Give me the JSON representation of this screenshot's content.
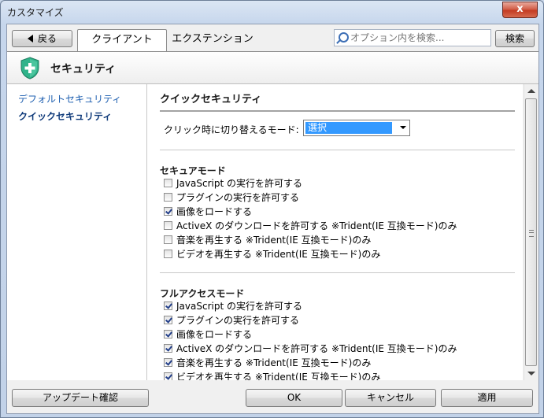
{
  "window": {
    "title": "カスタマイズ",
    "close_glyph": "x"
  },
  "toolbar": {
    "back_label": "戻る",
    "tabs": [
      {
        "label": "クライアント",
        "active": true
      },
      {
        "label": "エクステンション",
        "active": false
      }
    ],
    "search_placeholder": "オプション内を検索...",
    "search_button": "検索"
  },
  "header": {
    "title": "セキュリティ",
    "icon": "shield-plus-icon"
  },
  "sidebar": {
    "items": [
      {
        "label": "デフォルトセキュリティ",
        "active": false
      },
      {
        "label": "クイックセキュリティ",
        "active": true
      }
    ]
  },
  "main": {
    "section_title": "クイックセキュリティ",
    "mode_label": "クリック時に切り替えるモード:",
    "mode_value": "選択",
    "groups": [
      {
        "title": "セキュアモード",
        "options": [
          {
            "label": "JavaScript の実行を許可する",
            "checked": false
          },
          {
            "label": "プラグインの実行を許可する",
            "checked": false
          },
          {
            "label": "画像をロードする",
            "checked": true
          },
          {
            "label": "ActiveX のダウンロードを許可する ※Trident(IE 互換モード)のみ",
            "checked": false
          },
          {
            "label": "音楽を再生する ※Trident(IE 互換モード)のみ",
            "checked": false
          },
          {
            "label": "ビデオを再生する ※Trident(IE 互換モード)のみ",
            "checked": false
          }
        ]
      },
      {
        "title": "フルアクセスモード",
        "options": [
          {
            "label": "JavaScript の実行を許可する",
            "checked": true
          },
          {
            "label": "プラグインの実行を許可する",
            "checked": true
          },
          {
            "label": "画像をロードする",
            "checked": true
          },
          {
            "label": "ActiveX のダウンロードを許可する ※Trident(IE 互換モード)のみ",
            "checked": true
          },
          {
            "label": "音楽を再生する ※Trident(IE 互換モード)のみ",
            "checked": true
          },
          {
            "label": "ビデオを再生する ※Trident(IE 互換モード)のみ",
            "checked": true
          }
        ]
      }
    ]
  },
  "footer": {
    "update_label": "アップデート確認",
    "ok_label": "OK",
    "cancel_label": "キャンセル",
    "apply_label": "適用"
  },
  "colors": {
    "accent": "#1e5fb0",
    "selection": "#3399ff",
    "shield": "#2fb38a"
  }
}
